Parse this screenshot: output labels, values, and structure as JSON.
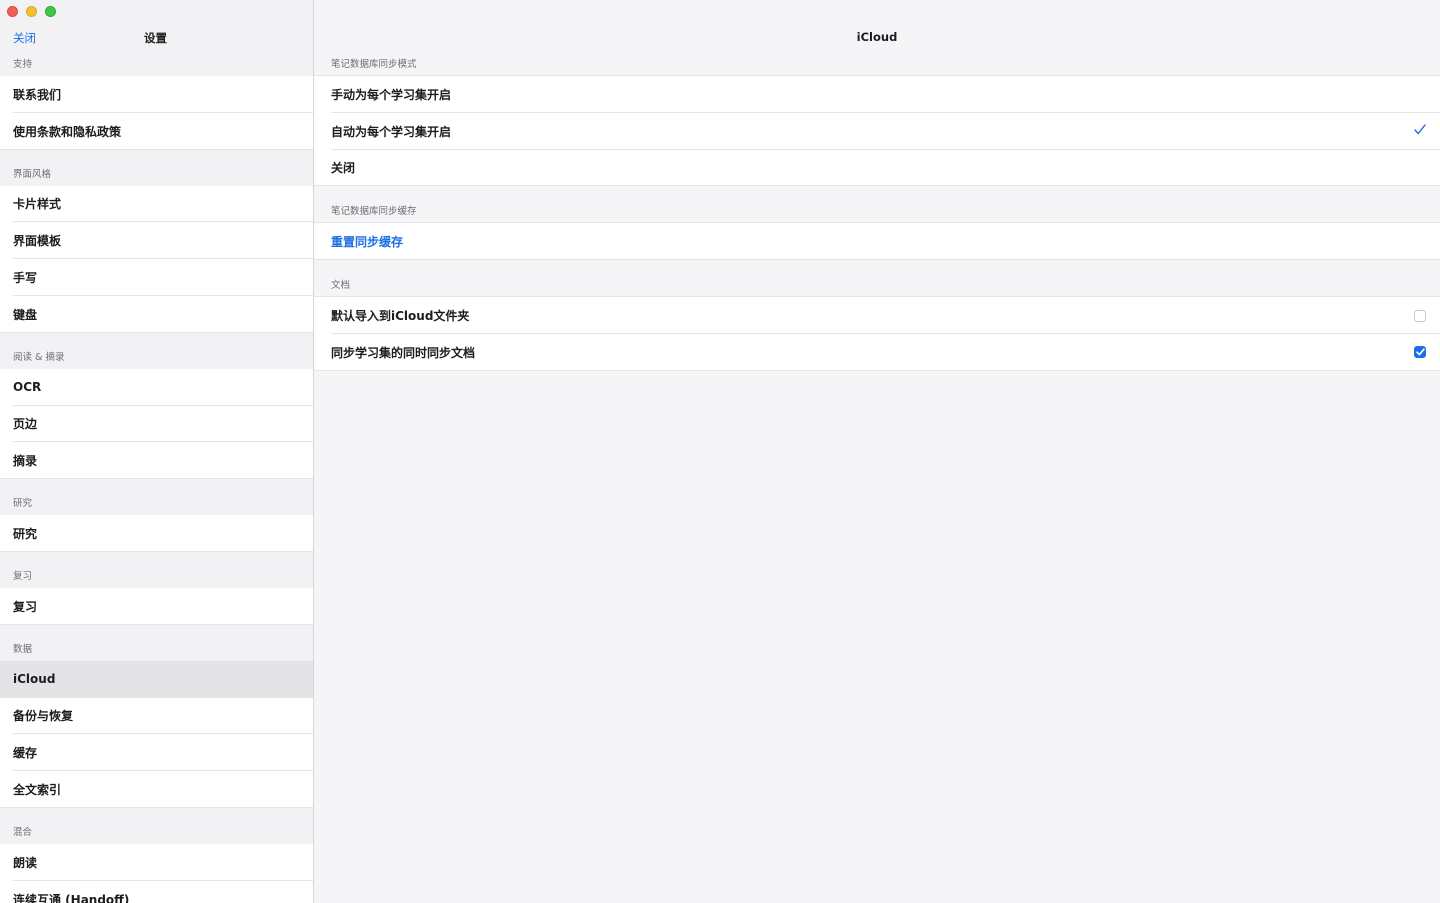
{
  "sidebar": {
    "close_label": "关闭",
    "title": "设置",
    "sections": [
      {
        "header": "支持",
        "items": [
          "联系我们",
          "使用条款和隐私政策"
        ]
      },
      {
        "header": "界面风格",
        "items": [
          "卡片样式",
          "界面模板",
          "手写",
          "键盘"
        ]
      },
      {
        "header": "阅读 & 摘录",
        "items": [
          "OCR",
          "页边",
          "摘录"
        ]
      },
      {
        "header": "研究",
        "items": [
          "研究"
        ]
      },
      {
        "header": "复习",
        "items": [
          "复习"
        ]
      },
      {
        "header": "数据",
        "items": [
          "iCloud",
          "备份与恢复",
          "缓存",
          "全文索引"
        ]
      },
      {
        "header": "混合",
        "items": [
          "朗读",
          "连续互通 (Handoff)"
        ]
      }
    ],
    "selected": "iCloud"
  },
  "main": {
    "title": "iCloud",
    "sync_mode": {
      "header": "笔记数据库同步模式",
      "options": [
        "手动为每个学习集开启",
        "自动为每个学习集开启",
        "关闭"
      ],
      "selected_index": 1
    },
    "sync_cache": {
      "header": "笔记数据库同步缓存",
      "reset_label": "重置同步缓存"
    },
    "documents": {
      "header": "文档",
      "options": [
        {
          "label": "默认导入到iCloud文件夹",
          "checked": false
        },
        {
          "label": "同步学习集的同时同步文档",
          "checked": true
        }
      ]
    }
  },
  "colors": {
    "accent": "#1e6ee8",
    "selected_row": "#e4e4e6"
  }
}
